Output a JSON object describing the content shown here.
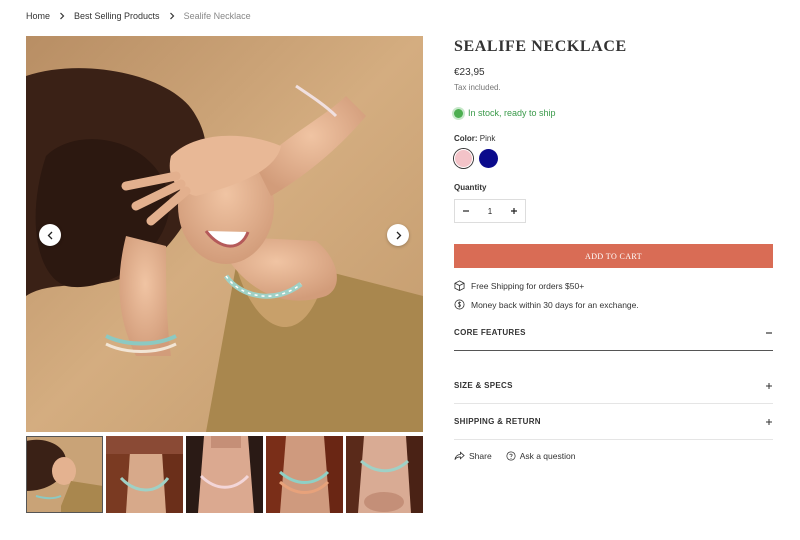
{
  "breadcrumb": {
    "home": "Home",
    "collection": "Best Selling Products",
    "current": "Sealife Necklace"
  },
  "product": {
    "title": "SEALIFE NECKLACE",
    "price": "€23,95",
    "tax_note": "Tax included.",
    "stock": "In stock, ready to ship",
    "color_label": "Color:",
    "color_value": "Pink",
    "swatches": [
      {
        "name": "Pink",
        "color": "#f3c3c8",
        "selected": true
      },
      {
        "name": "Navy",
        "color": "#0b0b8c",
        "selected": false
      }
    ],
    "quantity_label": "Quantity",
    "quantity": "1",
    "add_to_cart": "ADD TO CART",
    "perks": [
      {
        "icon": "box-icon",
        "text": "Free Shipping for orders $50+"
      },
      {
        "icon": "dollar-circle-icon",
        "text": "Money back within 30 days for an exchange."
      }
    ],
    "accordions": [
      {
        "label": "CORE FEATURES",
        "state": "open"
      },
      {
        "label": "SIZE & SPECS",
        "state": "closed"
      },
      {
        "label": "SHIPPING & RETURN",
        "state": "closed"
      }
    ],
    "share": "Share",
    "ask": "Ask a question"
  },
  "gallery": {
    "thumbnail_count": 5,
    "active_index": 0
  },
  "colors": {
    "accent": "#d96c55",
    "stock": "#3a9a4a"
  }
}
